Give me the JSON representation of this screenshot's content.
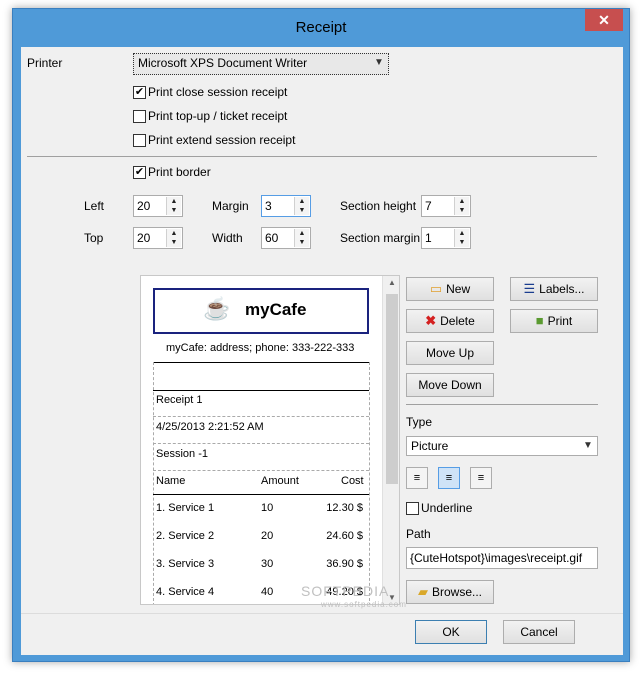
{
  "window": {
    "title": "Receipt",
    "close_glyph": "✕"
  },
  "printer": {
    "label": "Printer",
    "selected": "Microsoft XPS Document Writer"
  },
  "options": {
    "print_close_session": {
      "label": "Print close session receipt",
      "checked": true
    },
    "print_topup": {
      "label": "Print top-up / ticket receipt",
      "checked": false
    },
    "print_extend": {
      "label": "Print extend session receipt",
      "checked": false
    },
    "print_border": {
      "label": "Print border",
      "checked": true
    }
  },
  "layout": {
    "left_label": "Left",
    "left_value": "20",
    "top_label": "Top",
    "top_value": "20",
    "margin_label": "Margin",
    "margin_value": "3",
    "width_label": "Width",
    "width_value": "60",
    "section_height_label": "Section height",
    "section_height_value": "7",
    "section_margin_label": "Section margin",
    "section_margin_value": "1"
  },
  "receipt": {
    "brand": "myCafe",
    "address": "myCafe: address; phone: 333-222-333",
    "receipt_no": "Receipt 1",
    "datetime": "4/25/2013 2:21:52 AM",
    "session": "Session -1",
    "columns": [
      "Name",
      "Amount",
      "Cost"
    ],
    "rows": [
      {
        "name": "1. Service 1",
        "amount": "10",
        "cost": "12.30 $"
      },
      {
        "name": "2. Service 2",
        "amount": "20",
        "cost": "24.60 $"
      },
      {
        "name": "3. Service 3",
        "amount": "30",
        "cost": "36.90 $"
      },
      {
        "name": "4. Service 4",
        "amount": "40",
        "cost": "49.20 $"
      }
    ]
  },
  "actions": {
    "new": "New",
    "labels": "Labels...",
    "delete": "Delete",
    "print": "Print",
    "move_up": "Move Up",
    "move_down": "Move Down"
  },
  "section": {
    "type_label": "Type",
    "type_selected": "Picture",
    "underline_label": "Underline",
    "underline_checked": false,
    "path_label": "Path",
    "path_value": "{CuteHotspot}\\images\\receipt.gif",
    "browse": "Browse..."
  },
  "footer": {
    "ok": "OK",
    "cancel": "Cancel"
  },
  "watermark": {
    "main": "SOFTPEDIA",
    "sub": "www.softpedia.com"
  },
  "colors": {
    "title_bar": "#4f9ad8",
    "close_button": "#c74f4f",
    "dialog_bg": "#f0f0f0"
  }
}
